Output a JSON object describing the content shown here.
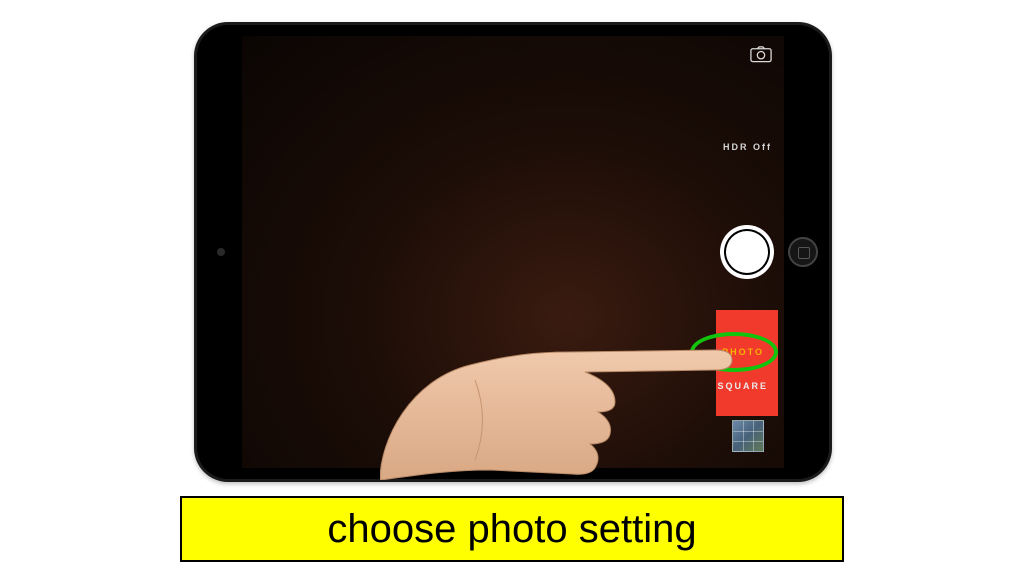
{
  "camera": {
    "hdr_label": "HDR Off",
    "modes": {
      "photo": "PHOTO",
      "square": "SQUARE"
    }
  },
  "caption": "choose photo setting"
}
